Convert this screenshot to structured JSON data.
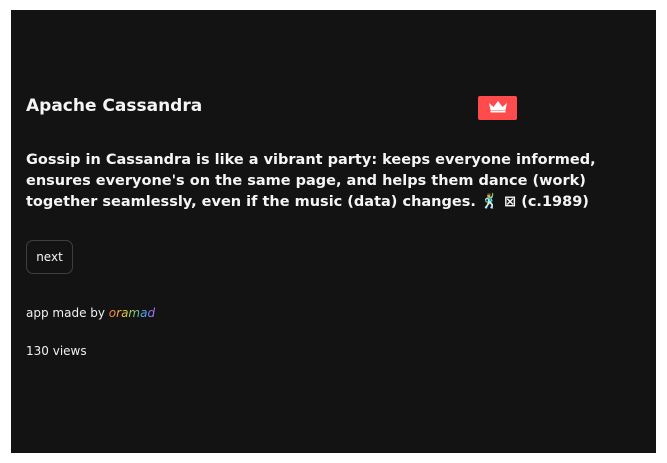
{
  "app": {
    "title": "Apache Cassandra",
    "logo_icon": "crown-icon",
    "accent_color": "#ff4b4b",
    "background_color": "#131313"
  },
  "main": {
    "body_text": "Gossip in Cassandra is like a vibrant party: keeps everyone informed, ensures everyone's on the same page, and helps them dance (work) together seamlessly, even if the music (data) changes. 🕺 ⊠ (c.1989)",
    "next_label": "next"
  },
  "footer": {
    "credit_prefix": "app made by ",
    "author": "oramad",
    "views": "130 views"
  }
}
